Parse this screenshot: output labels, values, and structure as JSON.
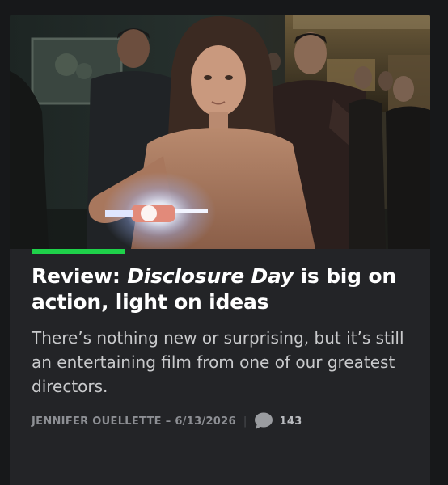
{
  "article": {
    "headline_prefix": "Review: ",
    "headline_title": "Disclosure Day",
    "headline_suffix": " is big on action, light on ideas",
    "dek": "There’s nothing new or surprising, but it’s still an entertaining film from one of our greatest directors.",
    "author": "JENNIFER OUELLETTE",
    "date_separator": " – ",
    "date": "6/13/2026",
    "meta_separator": "|",
    "comment_count": "143"
  },
  "colors": {
    "page_background": "#17181a",
    "card_background": "#232427",
    "accent": "#1fd14a",
    "headline_text": "#ffffff",
    "dek_text": "#c9cacc",
    "byline_text": "#8d8f94"
  },
  "icons": {
    "comments": "speech-bubble-icon"
  }
}
